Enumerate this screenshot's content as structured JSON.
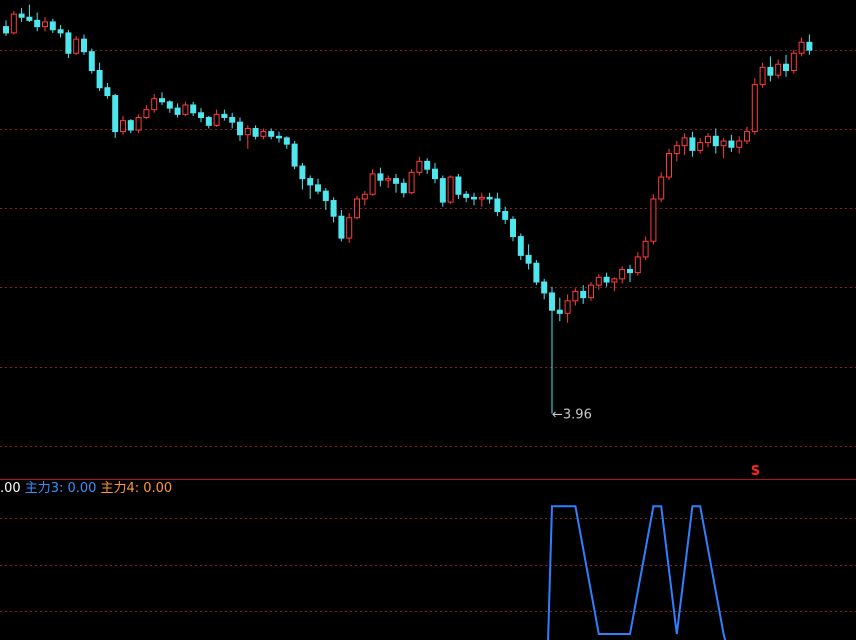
{
  "indicator_legend": {
    "item1_value": ".00",
    "item3_label": "主力3: ",
    "item3_value": "0.00",
    "item4_label": "主力4: ",
    "item4_value": "0.00"
  },
  "colors": {
    "background": "#000000",
    "up_candle": "#ff3b3b",
    "down_candle": "#4fe6ee",
    "flat_candle": "#ffffff",
    "grid": "#8a1f1f",
    "divider": "#b01515",
    "indicator_line": "#2f7fff",
    "label_blue": "#3a8fff",
    "label_orange": "#ff9a2a",
    "marker_text": "#c8c8c8",
    "signal": "#ff2020"
  },
  "chart_data": [
    {
      "type": "candlestick",
      "title": "",
      "ylim": [
        3.6,
        6.6
      ],
      "grid": true,
      "annotations": [
        {
          "text": "3.96",
          "arrow": "left",
          "candle_index": 70,
          "value": 3.96
        },
        {
          "text": "S",
          "candle_index": 96,
          "color": "#ff2020"
        }
      ],
      "candles": [
        [
          6.43,
          6.47,
          6.37,
          6.39
        ],
        [
          6.39,
          6.53,
          6.38,
          6.51
        ],
        [
          6.51,
          6.55,
          6.46,
          6.49
        ],
        [
          6.49,
          6.57,
          6.46,
          6.47
        ],
        [
          6.47,
          6.52,
          6.4,
          6.43
        ],
        [
          6.43,
          6.49,
          6.4,
          6.46
        ],
        [
          6.46,
          6.48,
          6.39,
          6.41
        ],
        [
          6.41,
          6.44,
          6.36,
          6.39
        ],
        [
          6.39,
          6.41,
          6.23,
          6.26
        ],
        [
          6.26,
          6.37,
          6.25,
          6.35
        ],
        [
          6.35,
          6.38,
          6.25,
          6.27
        ],
        [
          6.27,
          6.29,
          6.13,
          6.15
        ],
        [
          6.15,
          6.2,
          6.02,
          6.04
        ],
        [
          6.04,
          6.07,
          5.97,
          5.99
        ],
        [
          5.99,
          6.0,
          5.72,
          5.76
        ],
        [
          5.76,
          5.86,
          5.74,
          5.83
        ],
        [
          5.83,
          5.84,
          5.75,
          5.77
        ],
        [
          5.77,
          5.87,
          5.75,
          5.85
        ],
        [
          5.85,
          5.93,
          5.84,
          5.9
        ],
        [
          5.9,
          6.0,
          5.88,
          5.97
        ],
        [
          5.97,
          6.01,
          5.93,
          5.95
        ],
        [
          5.95,
          5.96,
          5.88,
          5.91
        ],
        [
          5.91,
          5.94,
          5.85,
          5.87
        ],
        [
          5.87,
          5.95,
          5.86,
          5.93
        ],
        [
          5.93,
          5.95,
          5.86,
          5.88
        ],
        [
          5.88,
          5.91,
          5.82,
          5.85
        ],
        [
          5.85,
          5.86,
          5.78,
          5.8
        ],
        [
          5.8,
          5.9,
          5.79,
          5.87
        ],
        [
          5.87,
          5.9,
          5.83,
          5.85
        ],
        [
          5.85,
          5.88,
          5.78,
          5.82
        ],
        [
          5.82,
          5.85,
          5.7,
          5.74
        ],
        [
          5.74,
          5.8,
          5.65,
          5.78
        ],
        [
          5.78,
          5.8,
          5.71,
          5.73
        ],
        [
          5.73,
          5.78,
          5.71,
          5.76
        ],
        [
          5.76,
          5.78,
          5.71,
          5.73
        ],
        [
          5.73,
          5.76,
          5.69,
          5.72
        ],
        [
          5.72,
          5.73,
          5.65,
          5.68
        ],
        [
          5.68,
          5.7,
          5.52,
          5.54
        ],
        [
          5.54,
          5.56,
          5.39,
          5.46
        ],
        [
          5.46,
          5.48,
          5.33,
          5.42
        ],
        [
          5.42,
          5.46,
          5.36,
          5.38
        ],
        [
          5.38,
          5.4,
          5.26,
          5.32
        ],
        [
          5.32,
          5.34,
          5.18,
          5.22
        ],
        [
          5.22,
          5.26,
          5.06,
          5.08
        ],
        [
          5.08,
          5.24,
          5.05,
          5.21
        ],
        [
          5.21,
          5.35,
          5.2,
          5.33
        ],
        [
          5.33,
          5.38,
          5.29,
          5.36
        ],
        [
          5.36,
          5.52,
          5.35,
          5.49
        ],
        [
          5.49,
          5.53,
          5.41,
          5.45
        ],
        [
          5.45,
          5.48,
          5.4,
          5.46
        ],
        [
          5.46,
          5.49,
          5.37,
          5.43
        ],
        [
          5.43,
          5.46,
          5.34,
          5.37
        ],
        [
          5.37,
          5.52,
          5.36,
          5.5
        ],
        [
          5.5,
          5.6,
          5.48,
          5.57
        ],
        [
          5.57,
          5.59,
          5.49,
          5.52
        ],
        [
          5.52,
          5.56,
          5.43,
          5.46
        ],
        [
          5.46,
          5.48,
          5.28,
          5.31
        ],
        [
          5.31,
          5.48,
          5.3,
          5.47
        ],
        [
          5.47,
          5.49,
          5.33,
          5.36
        ],
        [
          5.36,
          5.38,
          5.31,
          5.34
        ],
        [
          5.34,
          5.37,
          5.29,
          5.33
        ],
        [
          5.33,
          5.37,
          5.28,
          5.34
        ],
        [
          5.34,
          5.37,
          5.3,
          5.33
        ],
        [
          5.33,
          5.37,
          5.22,
          5.25
        ],
        [
          5.25,
          5.28,
          5.17,
          5.2
        ],
        [
          5.2,
          5.22,
          5.06,
          5.09
        ],
        [
          5.09,
          5.11,
          4.94,
          4.97
        ],
        [
          4.97,
          5.04,
          4.88,
          4.92
        ],
        [
          4.92,
          4.94,
          4.78,
          4.8
        ],
        [
          4.8,
          4.82,
          4.69,
          4.73
        ],
        [
          4.73,
          4.77,
          3.96,
          4.62
        ],
        [
          4.62,
          4.7,
          4.55,
          4.6
        ],
        [
          4.6,
          4.72,
          4.54,
          4.68
        ],
        [
          4.68,
          4.76,
          4.65,
          4.74
        ],
        [
          4.74,
          4.78,
          4.66,
          4.7
        ],
        [
          4.7,
          4.8,
          4.68,
          4.78
        ],
        [
          4.78,
          4.85,
          4.75,
          4.83
        ],
        [
          4.83,
          4.86,
          4.77,
          4.8
        ],
        [
          4.8,
          4.83,
          4.74,
          4.82
        ],
        [
          4.82,
          4.9,
          4.79,
          4.88
        ],
        [
          4.88,
          4.91,
          4.8,
          4.86
        ],
        [
          4.86,
          4.99,
          4.84,
          4.96
        ],
        [
          4.96,
          5.09,
          4.94,
          5.06
        ],
        [
          5.06,
          5.36,
          5.04,
          5.33
        ],
        [
          5.33,
          5.5,
          5.31,
          5.47
        ],
        [
          5.47,
          5.65,
          5.45,
          5.62
        ],
        [
          5.62,
          5.7,
          5.57,
          5.67
        ],
        [
          5.67,
          5.75,
          5.61,
          5.72
        ],
        [
          5.72,
          5.76,
          5.6,
          5.64
        ],
        [
          5.64,
          5.72,
          5.62,
          5.69
        ],
        [
          5.69,
          5.75,
          5.66,
          5.73
        ],
        [
          5.73,
          5.78,
          5.62,
          5.67
        ],
        [
          5.67,
          5.72,
          5.59,
          5.7
        ],
        [
          5.7,
          5.74,
          5.63,
          5.66
        ],
        [
          5.66,
          5.73,
          5.62,
          5.7
        ],
        [
          5.7,
          5.79,
          5.68,
          5.76
        ],
        [
          5.76,
          6.1,
          5.74,
          6.06
        ],
        [
          6.06,
          6.2,
          6.04,
          6.17
        ],
        [
          6.17,
          6.24,
          6.08,
          6.12
        ],
        [
          6.12,
          6.22,
          6.1,
          6.19
        ],
        [
          6.19,
          6.25,
          6.11,
          6.15
        ],
        [
          6.15,
          6.28,
          6.13,
          6.26
        ],
        [
          6.26,
          6.36,
          6.24,
          6.33
        ],
        [
          6.33,
          6.38,
          6.25,
          6.28
        ]
      ]
    },
    {
      "type": "line",
      "title": "",
      "ylim": [
        0,
        1
      ],
      "grid": true,
      "series": [
        {
          "points": [
            [
              70,
              0.99
            ],
            [
              73,
              0.99
            ],
            [
              76,
              0.0
            ],
            [
              80,
              0.0
            ],
            [
              83,
              0.99
            ],
            [
              84,
              0.99
            ],
            [
              86,
              0.0
            ],
            [
              88,
              0.99
            ],
            [
              89,
              0.99
            ],
            [
              92,
              0.0
            ]
          ]
        }
      ]
    }
  ]
}
